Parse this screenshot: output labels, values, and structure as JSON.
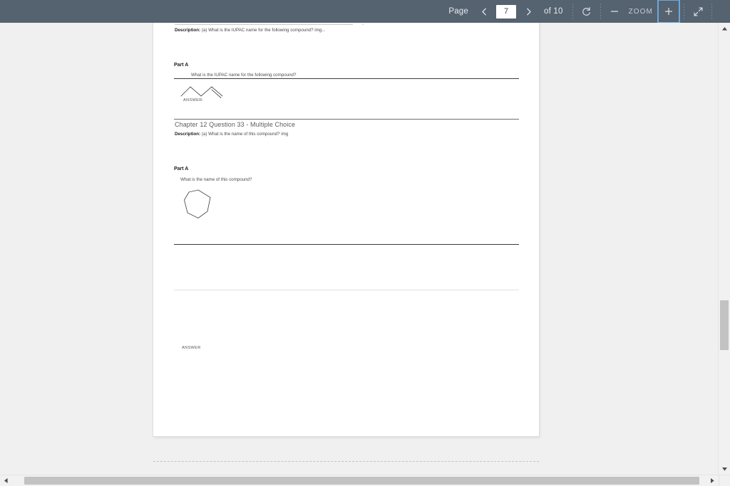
{
  "toolbar": {
    "page_label": "Page",
    "prev_page_icon": "chevron-left-icon",
    "page_number_value": "7",
    "next_page_icon": "chevron-right-icon",
    "of_label": "of 10",
    "total_pages": "10",
    "rotate_icon": "rotate-icon",
    "zoom_out_label": "−",
    "zoom_label": "ZOOM",
    "zoom_in_label": "+",
    "fit_icon": "fit-to-screen-icon",
    "background_color": "#556270",
    "accent_color": "#6ea8d8"
  },
  "document": {
    "blocks": [
      {
        "name": "description-line-1",
        "label": "Description:",
        "text": " (a) What is the IUPAC name for the following compound? img..."
      },
      {
        "name": "part-a-heading-1",
        "text": "Part A"
      },
      {
        "name": "question-text-1",
        "text": "What is the IUPAC name for the following compound?"
      },
      {
        "name": "answer-label-1",
        "text": "ANSWER:"
      },
      {
        "name": "chapter-heading",
        "text": "Chapter 12 Question 33 - Multiple Choice"
      },
      {
        "name": "description-line-2",
        "label": "Description:",
        "text": " (a) What is the name of this compound? img"
      },
      {
        "name": "part-a-heading-2",
        "text": "Part A"
      },
      {
        "name": "question-text-2",
        "text": "What is the name of this compound?"
      },
      {
        "name": "answer-label-2",
        "text": "ANSWER"
      }
    ],
    "molecule_1": {
      "name": "alkene-skeletal-structure",
      "description": "zigzag carbon chain with terminal double bond"
    },
    "molecule_2": {
      "name": "cycloheptane-ring",
      "description": "seven-membered carbon ring"
    }
  },
  "scrollbars": {
    "vertical_up_icon": "caret-up-icon",
    "vertical_down_icon": "caret-down-icon",
    "horizontal_left_icon": "caret-left-icon",
    "horizontal_right_icon": "caret-right-icon"
  }
}
